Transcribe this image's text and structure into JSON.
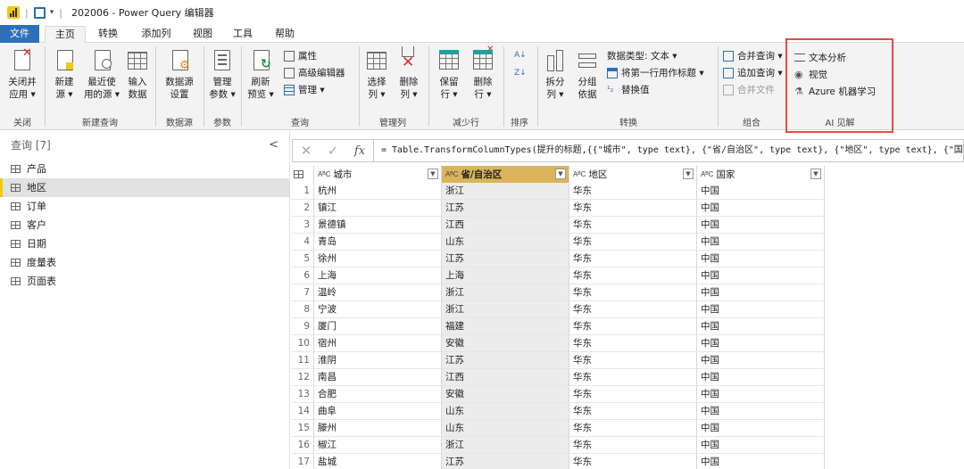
{
  "window": {
    "title": "202006 - Power Query 编辑器"
  },
  "tabs": [
    "文件",
    "主页",
    "转换",
    "添加列",
    "视图",
    "工具",
    "帮助"
  ],
  "active_tab": "主页",
  "ribbon": {
    "close": {
      "btn": "关闭并\n应用 ▾",
      "group": "关闭"
    },
    "new_query": {
      "new_source": "新建\n源 ▾",
      "recent": "最近使\n用的源 ▾",
      "enter_data": "输入\n数据",
      "group": "新建查询"
    },
    "datasource": {
      "settings": "数据源\n设置",
      "group": "数据源"
    },
    "params": {
      "manage": "管理\n参数 ▾",
      "group": "参数"
    },
    "query": {
      "refresh": "刷新\n预览 ▾",
      "properties": "属性",
      "advanced": "高级编辑器",
      "manage": "管理 ▾",
      "group": "查询"
    },
    "manage_cols": {
      "choose": "选择\n列 ▾",
      "remove": "删除\n列 ▾",
      "group": "管理列"
    },
    "reduce_rows": {
      "keep": "保留\n行 ▾",
      "remove": "删除\n行 ▾",
      "group": "减少行"
    },
    "sort": {
      "group": "排序"
    },
    "transform": {
      "split": "拆分\n列 ▾",
      "groupby": "分组\n依据",
      "datatype": "数据类型: 文本 ▾",
      "first_row": "将第一行用作标题 ▾",
      "replace": "替换值",
      "group": "转换"
    },
    "combine": {
      "merge": "合并查询 ▾",
      "append": "追加查询 ▾",
      "combine_files": "合并文件",
      "group": "组合"
    },
    "ai": {
      "text_analytics": "文本分析",
      "vision": "视觉",
      "azure_ml": "Azure 机器学习",
      "group": "AI 见解"
    }
  },
  "queries_pane": {
    "header": "查询 [7]",
    "items": [
      "产品",
      "地区",
      "订单",
      "客户",
      "日期",
      "度量表",
      "页面表"
    ],
    "selected": "地区"
  },
  "formula": "= Table.TransformColumnTypes(提升的标题,{{\"城市\", type text}, {\"省/自治区\", type text}, {\"地区\", type text}, {\"国",
  "table": {
    "columns": [
      "城市",
      "省/自治区",
      "地区",
      "国家"
    ],
    "type_badge": "A B C",
    "rows": [
      [
        "1",
        "杭州",
        "浙江",
        "华东",
        "中国"
      ],
      [
        "2",
        "镇江",
        "江苏",
        "华东",
        "中国"
      ],
      [
        "3",
        "景德镇",
        "江西",
        "华东",
        "中国"
      ],
      [
        "4",
        "青岛",
        "山东",
        "华东",
        "中国"
      ],
      [
        "5",
        "徐州",
        "江苏",
        "华东",
        "中国"
      ],
      [
        "6",
        "上海",
        "上海",
        "华东",
        "中国"
      ],
      [
        "7",
        "温岭",
        "浙江",
        "华东",
        "中国"
      ],
      [
        "8",
        "宁波",
        "浙江",
        "华东",
        "中国"
      ],
      [
        "9",
        "厦门",
        "福建",
        "华东",
        "中国"
      ],
      [
        "10",
        "宿州",
        "安徽",
        "华东",
        "中国"
      ],
      [
        "11",
        "淮阴",
        "江苏",
        "华东",
        "中国"
      ],
      [
        "12",
        "南昌",
        "江西",
        "华东",
        "中国"
      ],
      [
        "13",
        "合肥",
        "安徽",
        "华东",
        "中国"
      ],
      [
        "14",
        "曲阜",
        "山东",
        "华东",
        "中国"
      ],
      [
        "15",
        "滕州",
        "山东",
        "华东",
        "中国"
      ],
      [
        "16",
        "椒江",
        "浙江",
        "华东",
        "中国"
      ],
      [
        "17",
        "盐城",
        "江苏",
        "华东",
        "中国"
      ]
    ]
  },
  "colors": {
    "file_tab": "#2f6fba",
    "accent_yellow": "#f2c811",
    "header_underline": "#2aa198",
    "highlight_box": "#e74c3c",
    "selected_col": "#d9b45a"
  }
}
